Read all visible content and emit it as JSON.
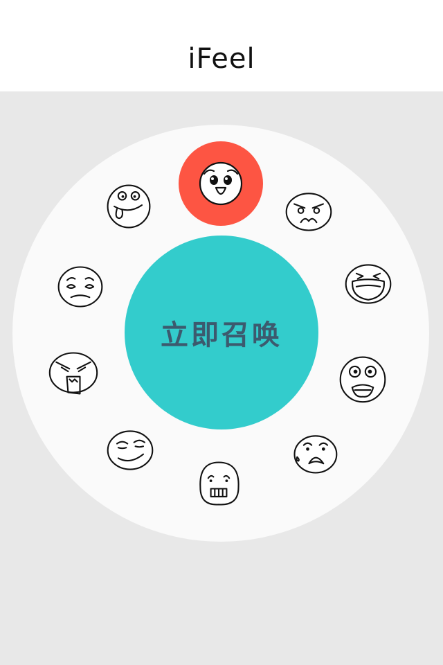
{
  "app": {
    "title": "iFeel"
  },
  "colors": {
    "background": "#e8e8e8",
    "header": "#ffffff",
    "wheel": "#fafafa",
    "center": "#33cccc",
    "selected": "#fd5543"
  },
  "center_button": {
    "label": "立即召唤"
  },
  "emojis": [
    {
      "name": "excited",
      "icon": "excited-face-icon",
      "selected": true
    },
    {
      "name": "angry",
      "icon": "angry-face-icon",
      "selected": false
    },
    {
      "name": "crying",
      "icon": "crying-face-icon",
      "selected": false
    },
    {
      "name": "shocked",
      "icon": "shocked-face-icon",
      "selected": false
    },
    {
      "name": "scared",
      "icon": "scared-face-icon",
      "selected": false
    },
    {
      "name": "nervous",
      "icon": "nervous-face-icon",
      "selected": false
    },
    {
      "name": "smug",
      "icon": "smug-face-icon",
      "selected": false
    },
    {
      "name": "rage",
      "icon": "rage-face-icon",
      "selected": false
    },
    {
      "name": "sad",
      "icon": "sad-face-icon",
      "selected": false
    },
    {
      "name": "silly",
      "icon": "silly-face-icon",
      "selected": false
    }
  ]
}
